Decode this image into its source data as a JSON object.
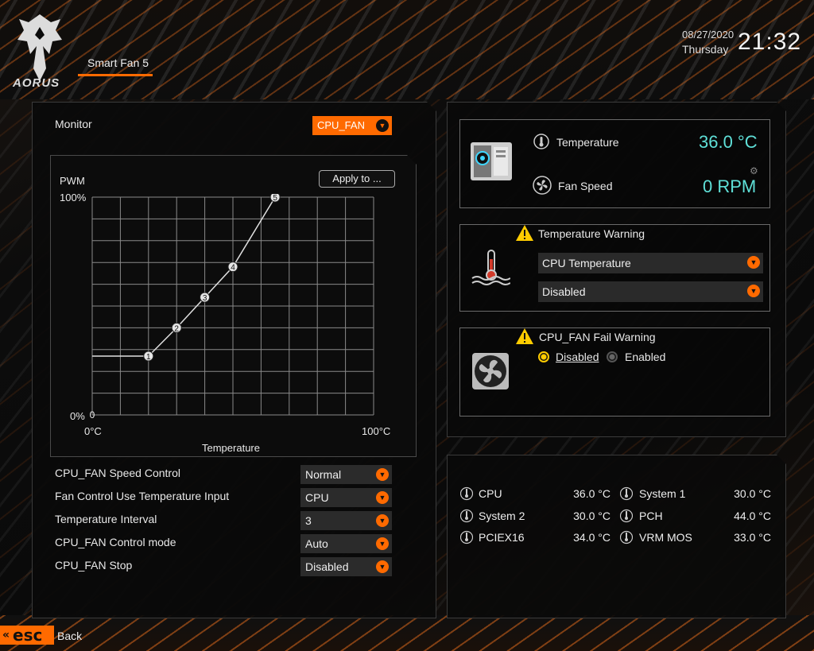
{
  "header": {
    "brand": "AORUS",
    "page_title": "Smart Fan 5",
    "date": "08/27/2020",
    "day": "Thursday",
    "time": "21:32"
  },
  "left_panel": {
    "monitor_label": "Monitor",
    "monitor_value": "CPU_FAN",
    "apply_button": "Apply to ...",
    "chart": {
      "y_label": "PWM",
      "y_max_label": "100%",
      "y_min_label": "0%",
      "x_min_label": "0°C",
      "x_max_label": "100°C",
      "x_label": "Temperature",
      "origin_label": "0"
    },
    "settings": [
      {
        "label": "CPU_FAN Speed Control",
        "value": "Normal"
      },
      {
        "label": "Fan Control Use Temperature Input",
        "value": "CPU"
      },
      {
        "label": "Temperature Interval",
        "value": "3"
      },
      {
        "label": "CPU_FAN Control mode",
        "value": "Auto"
      },
      {
        "label": "CPU_FAN Stop",
        "value": "Disabled"
      }
    ]
  },
  "fan_curve": {
    "points": [
      {
        "id": "1",
        "temp": 20,
        "pwm": 27
      },
      {
        "id": "2",
        "temp": 30,
        "pwm": 40
      },
      {
        "id": "3",
        "temp": 40,
        "pwm": 54
      },
      {
        "id": "4",
        "temp": 50,
        "pwm": 68
      },
      {
        "id": "5",
        "temp": 65,
        "pwm": 100
      }
    ],
    "flat_start": {
      "temp": 0,
      "pwm": 27
    }
  },
  "status": {
    "temperature_label": "Temperature",
    "temperature_value": "36.0 °C",
    "fan_speed_label": "Fan Speed",
    "fan_speed_value": "0 RPM"
  },
  "temp_warning": {
    "title": "Temperature Warning",
    "source": "CPU Temperature",
    "value": "Disabled"
  },
  "fail_warning": {
    "title": "CPU_FAN Fail Warning",
    "options": [
      "Disabled",
      "Enabled"
    ],
    "selected": "Disabled"
  },
  "sensors": [
    {
      "name": "CPU",
      "value": "36.0 °C"
    },
    {
      "name": "System 1",
      "value": "30.0 °C"
    },
    {
      "name": "System 2",
      "value": "30.0 °C"
    },
    {
      "name": "PCH",
      "value": "44.0 °C"
    },
    {
      "name": "PCIEX16",
      "value": "34.0 °C"
    },
    {
      "name": "VRM MOS",
      "value": "33.0 °C"
    }
  ],
  "footer": {
    "esc_label": "esc",
    "back_label": "Back"
  },
  "colors": {
    "accent": "#ff6a00",
    "value_cyan": "#5fe0d8",
    "warning_yellow": "#ffcc00"
  }
}
